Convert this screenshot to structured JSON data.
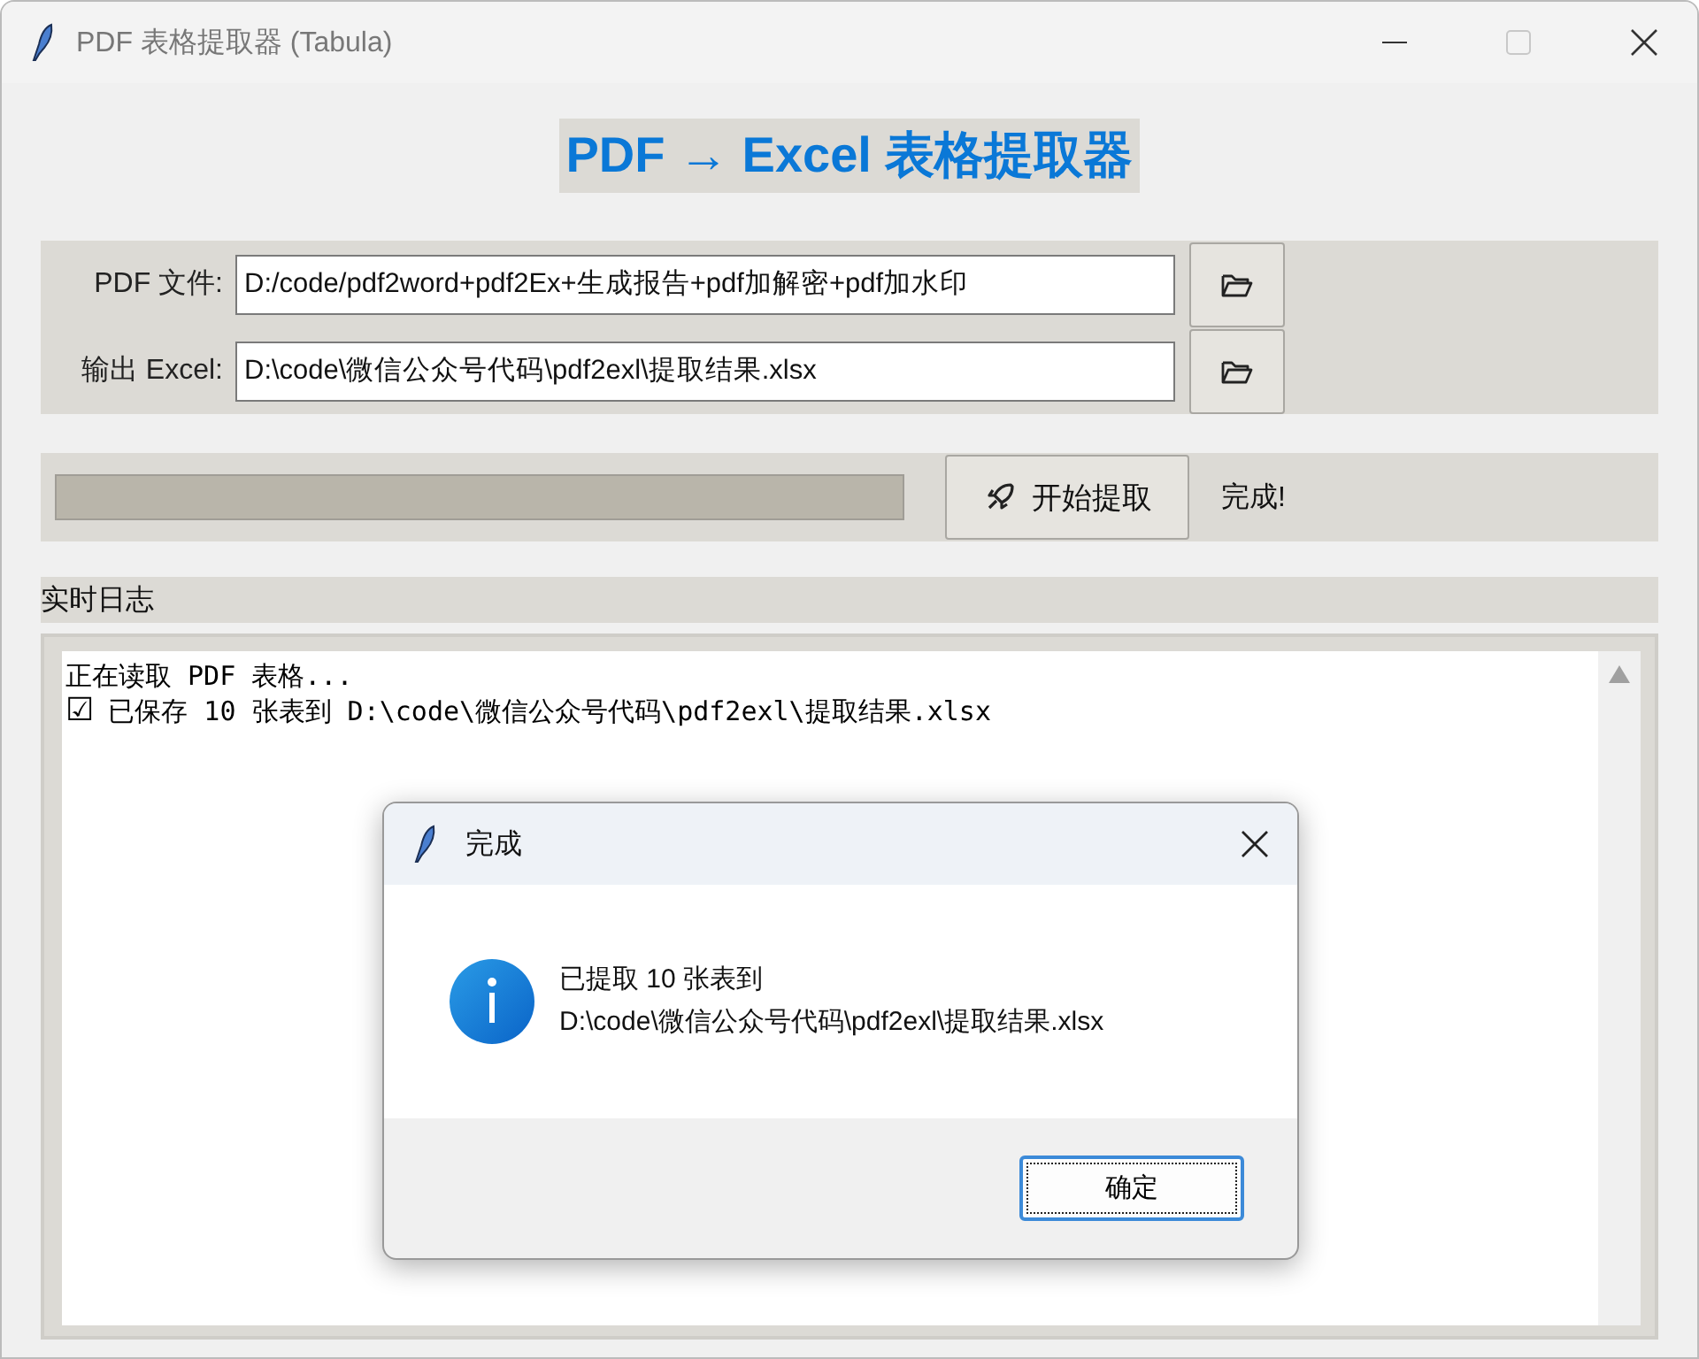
{
  "window": {
    "title": "PDF 表格提取器 (Tabula)"
  },
  "heading": "PDF → Excel 表格提取器",
  "files": [
    {
      "label": "PDF 文件:",
      "value": "D:/code/pdf2word+pdf2Ex+生成报告+pdf加解密+pdf加水印"
    },
    {
      "label": "输出 Excel:",
      "value": "D:\\code\\微信公众号代码\\pdf2exl\\提取结果.xlsx"
    }
  ],
  "start_button": "开始提取",
  "status": "完成!",
  "log": {
    "title": "实时日志",
    "lines": [
      {
        "text": "正在读取 PDF 表格..."
      },
      {
        "icon": "☑",
        "text": "已保存 10 张表到 D:\\code\\微信公众号代码\\pdf2exl\\提取结果.xlsx"
      }
    ]
  },
  "dialog": {
    "title": "完成",
    "lines": [
      "已提取 10 张表到",
      "D:\\code\\微信公众号代码\\pdf2exl\\提取结果.xlsx"
    ],
    "button": "确定"
  }
}
